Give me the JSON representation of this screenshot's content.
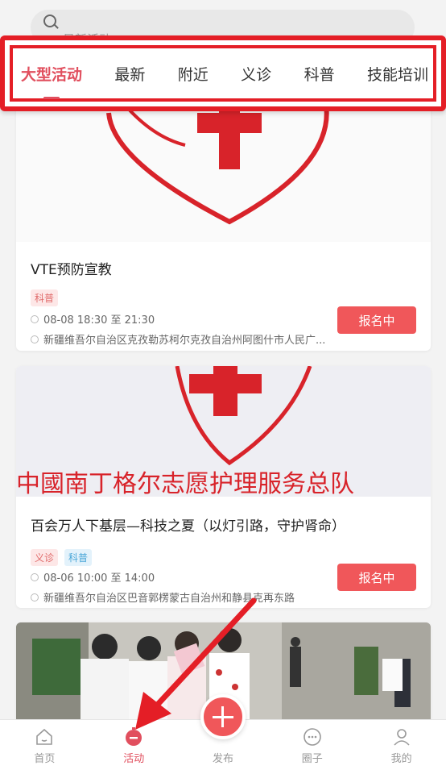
{
  "search": {
    "placeholder": "最新活动"
  },
  "tabs": [
    {
      "label": "大型活动",
      "active": true
    },
    {
      "label": "最新"
    },
    {
      "label": "附近"
    },
    {
      "label": "义诊"
    },
    {
      "label": "科普"
    },
    {
      "label": "技能培训"
    }
  ],
  "activities": [
    {
      "title": "VTE预防宣教",
      "tags": [
        "科普"
      ],
      "time": "08-08 18:30 至 21:30",
      "location": "新疆维吾尔自治区克孜勒苏柯尔克孜自治州阿图什市人民广...",
      "button": "报名中"
    },
    {
      "title": "百会万人下基层—科技之夏（以灯引路，守护肾命）",
      "tags": [
        "义诊",
        "科普"
      ],
      "time": "08-06 10:00 至 14:00",
      "location": "新疆维吾尔自治区巴音郭楞蒙古自治州和静县克再东路",
      "button": "报名中",
      "banner_text": "中國南丁格尔志愿护理服务总队"
    }
  ],
  "bottom_nav": [
    {
      "label": "首页",
      "icon": "home-icon"
    },
    {
      "label": "活动",
      "icon": "stopwatch-icon",
      "active": true
    },
    {
      "label": "发布",
      "icon": "plus-icon"
    },
    {
      "label": "圈子",
      "icon": "chat-icon"
    },
    {
      "label": "我的",
      "icon": "user-icon"
    }
  ],
  "colors": {
    "accent": "#e14f5e",
    "highlight": "#e41e26",
    "button": "#f0575a",
    "red_cross": "#d8232a"
  }
}
